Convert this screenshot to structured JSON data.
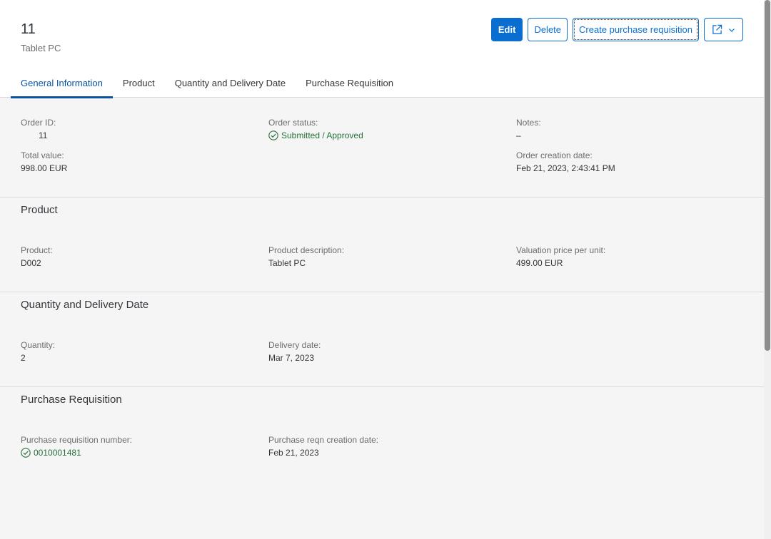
{
  "header": {
    "title": "11",
    "subtitle": "Tablet PC",
    "actions": {
      "edit": "Edit",
      "delete": "Delete",
      "create_pr": "Create purchase requisition"
    }
  },
  "tabs": [
    "General Information",
    "Product",
    "Quantity and Delivery Date",
    "Purchase Requisition"
  ],
  "general": {
    "order_id_label": "Order ID:",
    "order_id": "11",
    "order_status_label": "Order status:",
    "order_status": "Submitted / Approved",
    "notes_label": "Notes:",
    "notes": "–",
    "total_value_label": "Total value:",
    "total_value": "998.00 EUR",
    "creation_date_label": "Order creation date:",
    "creation_date": "Feb 21, 2023, 2:43:41 PM"
  },
  "product": {
    "title": "Product",
    "product_label": "Product:",
    "product": "D002",
    "description_label": "Product description:",
    "description": "Tablet PC",
    "price_label": "Valuation price per unit:",
    "price": "499.00 EUR"
  },
  "quantity": {
    "title": "Quantity and Delivery Date",
    "quantity_label": "Quantity:",
    "quantity": "2",
    "delivery_label": "Delivery date:",
    "delivery": "Mar 7, 2023"
  },
  "requisition": {
    "title": "Purchase Requisition",
    "number_label": "Purchase requisition number:",
    "number": "0010001481",
    "date_label": "Purchase reqn creation date:",
    "date": "Feb 21, 2023"
  },
  "colors": {
    "accent": "#0a6ed1",
    "success": "#256f3a",
    "tab_active": "#0854a0"
  },
  "icons": {
    "share": "share-icon",
    "chevron": "chevron-down-icon",
    "status": "success-check-icon"
  }
}
